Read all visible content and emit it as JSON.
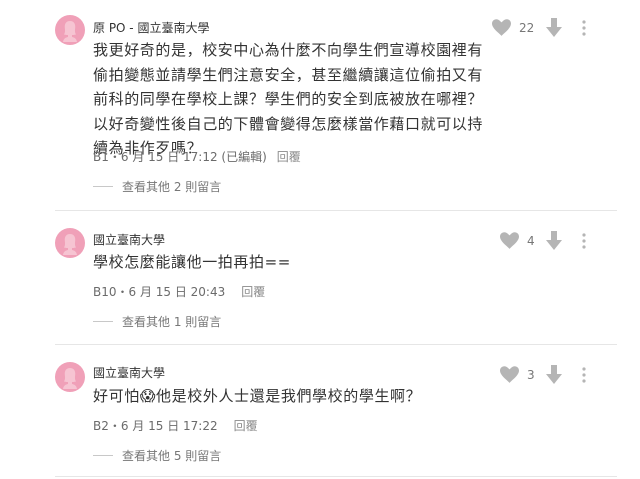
{
  "comments": [
    {
      "author": "原 PO - 國立臺南大學",
      "body": "我更好奇的是，校安中心為什麼不向學生們宣導校園裡有偷拍變態並請學生們注意安全，甚至繼續讓這位偷拍又有前科的同學在學校上課？學生們的安全到底被放在哪裡？以好奇變性後自己的下體會變得怎麼樣當作藉口就可以持續為非作歹嗎？",
      "floor_time": "B1・6 月 15 日 17:12 (已編輯)",
      "reply_label": "回覆",
      "likes": "22",
      "more_replies": "查看其他 2 則留言"
    },
    {
      "author": "國立臺南大學",
      "body": "學校怎麼能讓他一拍再拍==",
      "floor_time": "B10・6 月 15 日 20:43",
      "reply_label": "回覆",
      "likes": "4",
      "more_replies": "查看其他 1 則留言"
    },
    {
      "author": "國立臺南大學",
      "body": "好可怕😱他是校外人士還是我們學校的學生啊？",
      "floor_time": "B2・6 月 15 日 17:22",
      "reply_label": "回覆",
      "likes": "3",
      "more_replies": "查看其他 5 則留言"
    }
  ],
  "icons": {
    "avatar": "female-silhouette-icon",
    "like": "heart-icon",
    "down": "down-arrow-icon",
    "more": "vertical-dots-icon"
  },
  "colors": {
    "avatar_bg": "#f0a0b8",
    "text": "#333333",
    "muted": "#777777",
    "icon": "#b5b5b5"
  }
}
